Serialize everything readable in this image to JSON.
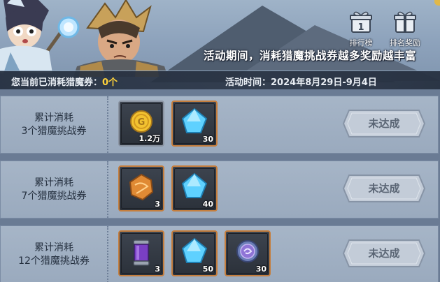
{
  "banner": {
    "slogan": "活动期间，消耗猎魔挑战券越多奖励越丰富",
    "buttons": [
      {
        "label": "排行榜",
        "icon": "ranking-gift-icon"
      },
      {
        "label": "排名奖励",
        "icon": "reward-gift-icon"
      }
    ]
  },
  "info": {
    "consumed_label": "您当前已消耗猎魔券：",
    "consumed_value": "0个",
    "time_label": "活动时间：",
    "time_value": "2024年8月29日-9月4日"
  },
  "rows": [
    {
      "line1": "累计消耗",
      "line2": "3个猎魔挑战券",
      "status": "未达成",
      "items": [
        {
          "icon": "gold-coin-icon",
          "qty": "1.2万"
        },
        {
          "icon": "blue-crystal-icon",
          "qty": "30"
        }
      ]
    },
    {
      "line1": "累计消耗",
      "line2": "7个猎魔挑战券",
      "status": "未达成",
      "items": [
        {
          "icon": "orange-ore-icon",
          "qty": "3"
        },
        {
          "icon": "blue-crystal-icon",
          "qty": "40"
        }
      ]
    },
    {
      "line1": "累计消耗",
      "line2": "12个猎魔挑战券",
      "status": "未达成",
      "items": [
        {
          "icon": "purple-potion-icon",
          "qty": "3"
        },
        {
          "icon": "blue-crystal-icon",
          "qty": "50"
        },
        {
          "icon": "purple-token-icon",
          "qty": "30"
        }
      ]
    }
  ]
}
